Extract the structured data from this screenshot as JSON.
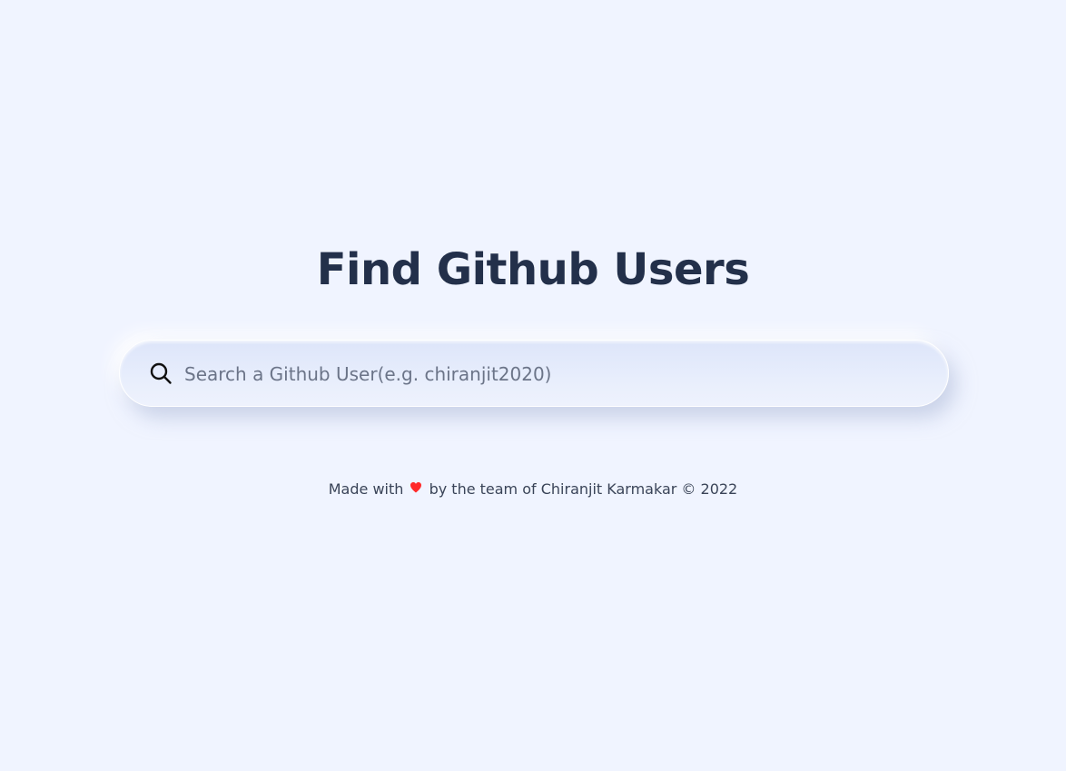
{
  "page": {
    "title": "Find Github Users"
  },
  "search": {
    "placeholder": "Search a Github User(e.g. chiranjit2020)",
    "value": "",
    "icon": "search-icon"
  },
  "footer": {
    "prefix": "Made with",
    "heart_icon": "heart-icon",
    "suffix": "by the team of Chiranjit Karmakar © 2022"
  },
  "colors": {
    "background": "#f0f4ff",
    "title_text": "#23304a",
    "heart": "#ff2a2a",
    "search_bar": "#e2e9fb"
  }
}
